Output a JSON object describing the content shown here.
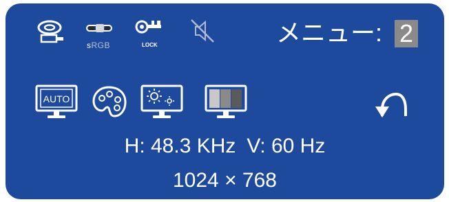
{
  "header": {
    "menu_label": "メニュー:",
    "menu_number": "2"
  },
  "status_icons": {
    "srgb_s": "s",
    "srgb_rgb": "RGB",
    "lock_label": "LOCK"
  },
  "modes": {
    "auto_label": "AUTO"
  },
  "signal": {
    "h_freq": "H: 48.3 KHz",
    "v_freq": "V: 60 Hz",
    "resolution": "1024 × 768"
  },
  "colors": {
    "panel_bg": "#1e4a9e",
    "text": "#ffffff",
    "number_highlight": "#8a8a8a"
  },
  "icons": [
    "disc-icon",
    "srgb-slider-icon",
    "key-lock-icon",
    "speaker-mute-icon",
    "auto-adjust-icon",
    "color-palette-icon",
    "brightness-icon",
    "color-bars-icon",
    "return-icon"
  ]
}
